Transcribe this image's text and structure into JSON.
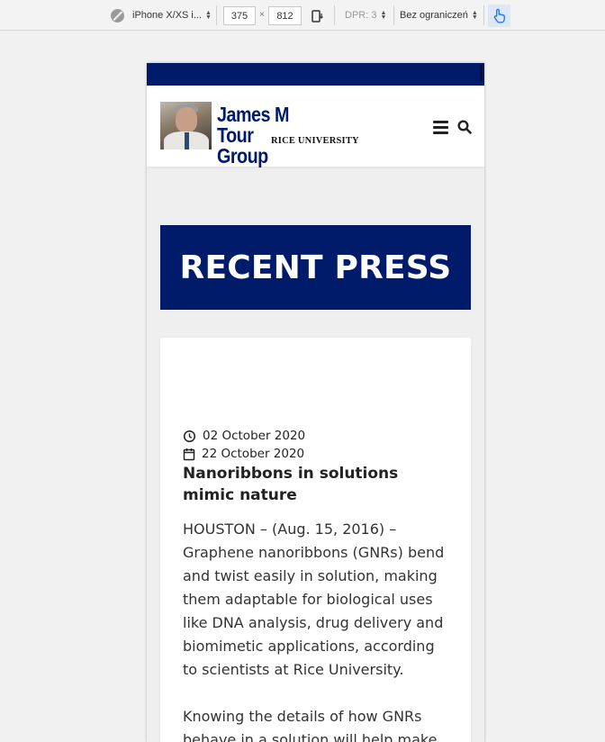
{
  "devtools": {
    "device": "iPhone X/XS i...",
    "width": "375",
    "times": "×",
    "height": "812",
    "dpr": "DPR: 3",
    "throttling": "Bez ograniczeń"
  },
  "site": {
    "logo_line1": "James M Tour",
    "logo_line2": "Group",
    "logo_sub": "RICE UNIVERSITY",
    "colors": {
      "brand": "#001b69"
    }
  },
  "hero": {
    "title": "RECENT PRESS"
  },
  "post": {
    "published": "02 October 2020",
    "modified": "22 October 2020",
    "title": "Nanoribbons in solutions mimic nature",
    "paragraphs": [
      "HOUSTON – (Aug. 15, 2016) – Graphene nanoribbons (GNRs) bend and twist easily in solution, making them adaptable for biological uses like DNA analysis, drug delivery and biomimetic applications, according to scientists at Rice University.",
      "Knowing the details of how GNRs behave in a solution will help make"
    ]
  }
}
